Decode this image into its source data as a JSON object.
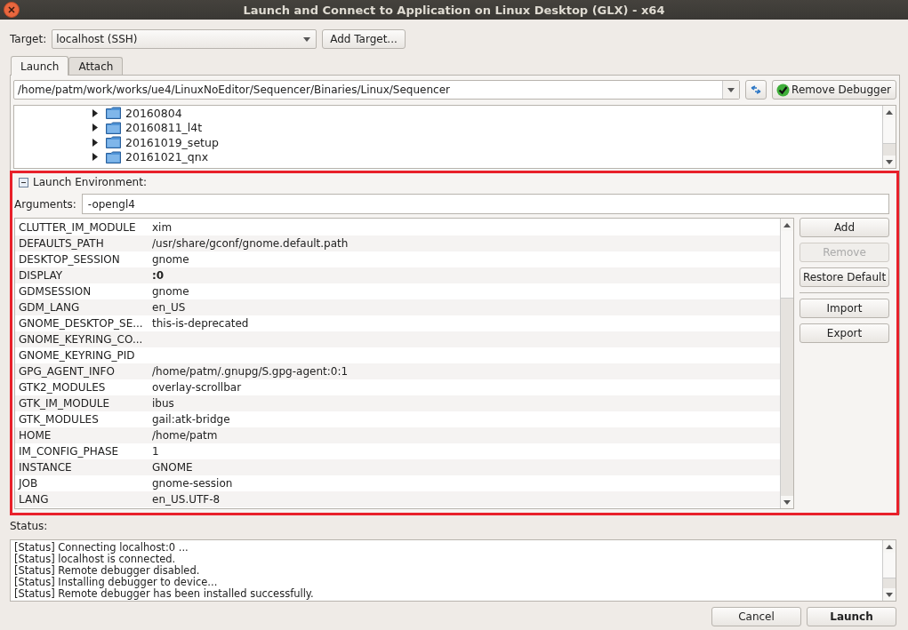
{
  "window": {
    "title": "Launch and Connect to Application on Linux Desktop (GLX) - x64"
  },
  "target": {
    "label": "Target:",
    "value": "localhost (SSH)",
    "add_button": "Add Target..."
  },
  "tabs": [
    {
      "label": "Launch",
      "selected": true
    },
    {
      "label": "Attach",
      "selected": false
    }
  ],
  "path": {
    "value": "/home/patm/work/works/ue4/LinuxNoEditor/Sequencer/Binaries/Linux/Sequencer",
    "remove_button": "Remove Debugger"
  },
  "tree": {
    "items": [
      {
        "label": "20160804",
        "expanded": false
      },
      {
        "label": "20160811_l4t",
        "expanded": false
      },
      {
        "label": "20161019_setup",
        "expanded": false
      },
      {
        "label": "20161021_qnx",
        "expanded": false
      }
    ]
  },
  "launch_environment": {
    "title": "Launch Environment:",
    "expanded": true,
    "arguments_label": "Arguments:",
    "arguments": "-opengl4",
    "variables": [
      {
        "name": "CLUTTER_IM_MODULE",
        "value": "xim",
        "bold": false
      },
      {
        "name": "DEFAULTS_PATH",
        "value": "/usr/share/gconf/gnome.default.path",
        "bold": false
      },
      {
        "name": "DESKTOP_SESSION",
        "value": "gnome",
        "bold": false
      },
      {
        "name": "DISPLAY",
        "value": ":0",
        "bold": true
      },
      {
        "name": "GDMSESSION",
        "value": "gnome",
        "bold": false
      },
      {
        "name": "GDM_LANG",
        "value": "en_US",
        "bold": false
      },
      {
        "name": "GNOME_DESKTOP_SE...",
        "value": "this-is-deprecated",
        "bold": false
      },
      {
        "name": "GNOME_KEYRING_CO..."
      },
      {
        "name": "GNOME_KEYRING_PID"
      },
      {
        "name": "GPG_AGENT_INFO",
        "value": "/home/patm/.gnupg/S.gpg-agent:0:1",
        "bold": false
      },
      {
        "name": "GTK2_MODULES",
        "value": "overlay-scrollbar",
        "bold": false
      },
      {
        "name": "GTK_IM_MODULE",
        "value": "ibus",
        "bold": false
      },
      {
        "name": "GTK_MODULES",
        "value": "gail:atk-bridge",
        "bold": false
      },
      {
        "name": "HOME",
        "value": "/home/patm",
        "bold": false
      },
      {
        "name": "IM_CONFIG_PHASE",
        "value": "1",
        "bold": false
      },
      {
        "name": "INSTANCE",
        "value": "GNOME",
        "bold": false
      },
      {
        "name": "JOB",
        "value": "gnome-session",
        "bold": false
      },
      {
        "name": "LANG",
        "value": "en_US.UTF-8",
        "bold": false
      }
    ],
    "buttons": [
      {
        "label": "Add",
        "disabled": false,
        "separator_before": false
      },
      {
        "label": "Remove",
        "disabled": true,
        "separator_before": false
      },
      {
        "label": "Restore Default",
        "disabled": false,
        "separator_before": false
      },
      {
        "label": "Import",
        "disabled": false,
        "separator_before": true
      },
      {
        "label": "Export",
        "disabled": false,
        "separator_before": false
      }
    ]
  },
  "status": {
    "label": "Status:",
    "lines": [
      "[Status] Connecting localhost:0 ...",
      "[Status] localhost is connected.",
      "[Status] Remote debugger disabled.",
      "[Status] Installing debugger to device...",
      "[Status] Remote debugger has been installed successfully."
    ]
  },
  "footer_buttons": [
    {
      "label": "Cancel",
      "default": false
    },
    {
      "label": "Launch",
      "default": true
    }
  ]
}
